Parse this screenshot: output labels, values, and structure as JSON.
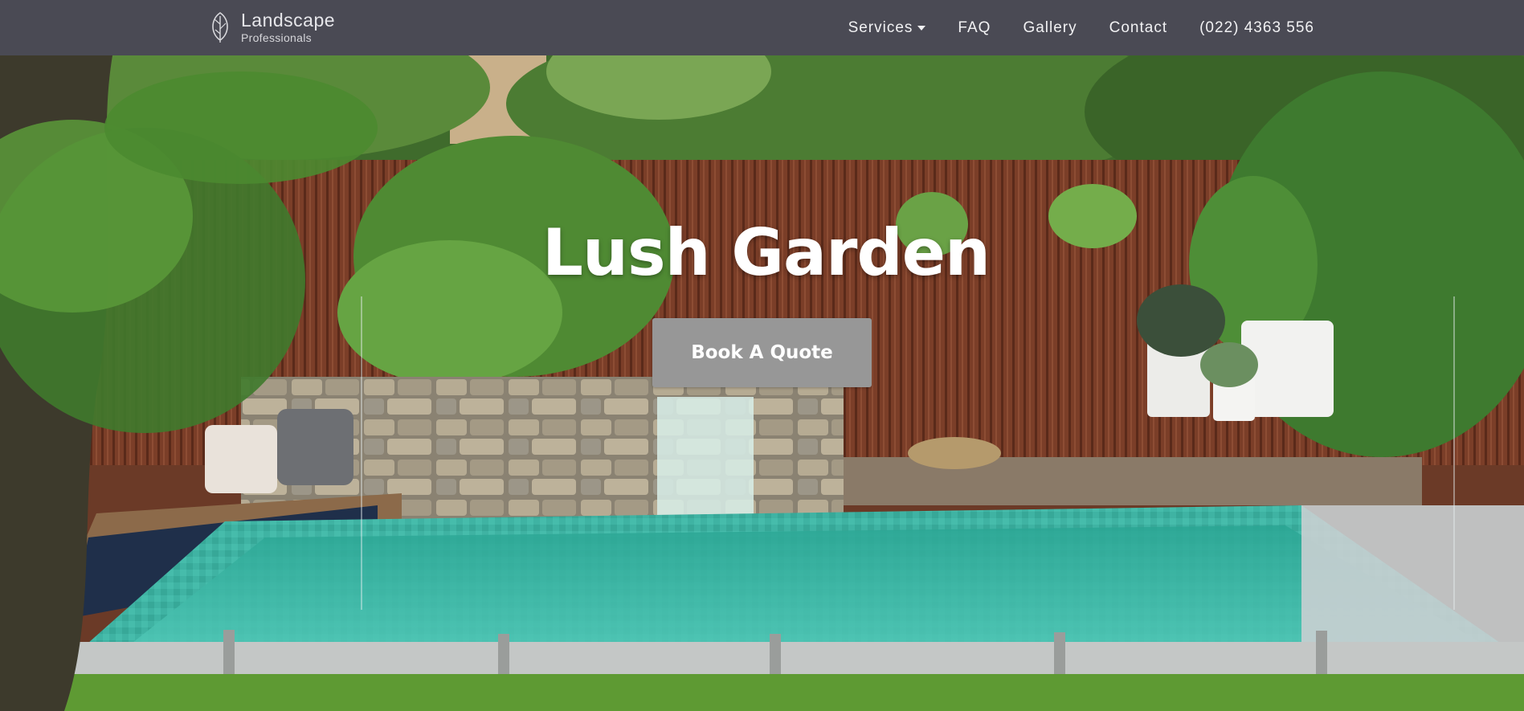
{
  "brand": {
    "name": "Landscape",
    "tagline": "Professionals"
  },
  "nav": {
    "items": [
      {
        "label": "Services",
        "has_dropdown": true
      },
      {
        "label": "FAQ"
      },
      {
        "label": "Gallery"
      },
      {
        "label": "Contact"
      },
      {
        "label": "(022) 4363 556"
      }
    ]
  },
  "hero": {
    "title": "Lush Garden",
    "cta_label": "Book A Quote"
  },
  "colors": {
    "navbar_bg": "#4a4a54",
    "cta_bg": "#979797",
    "pool": "#3fb3a3",
    "fence": "#7a3f2a",
    "foliage": "#3d6e2b"
  },
  "icons": {
    "brand_mark": "leaf-icon",
    "dropdown": "caret-down-icon"
  }
}
